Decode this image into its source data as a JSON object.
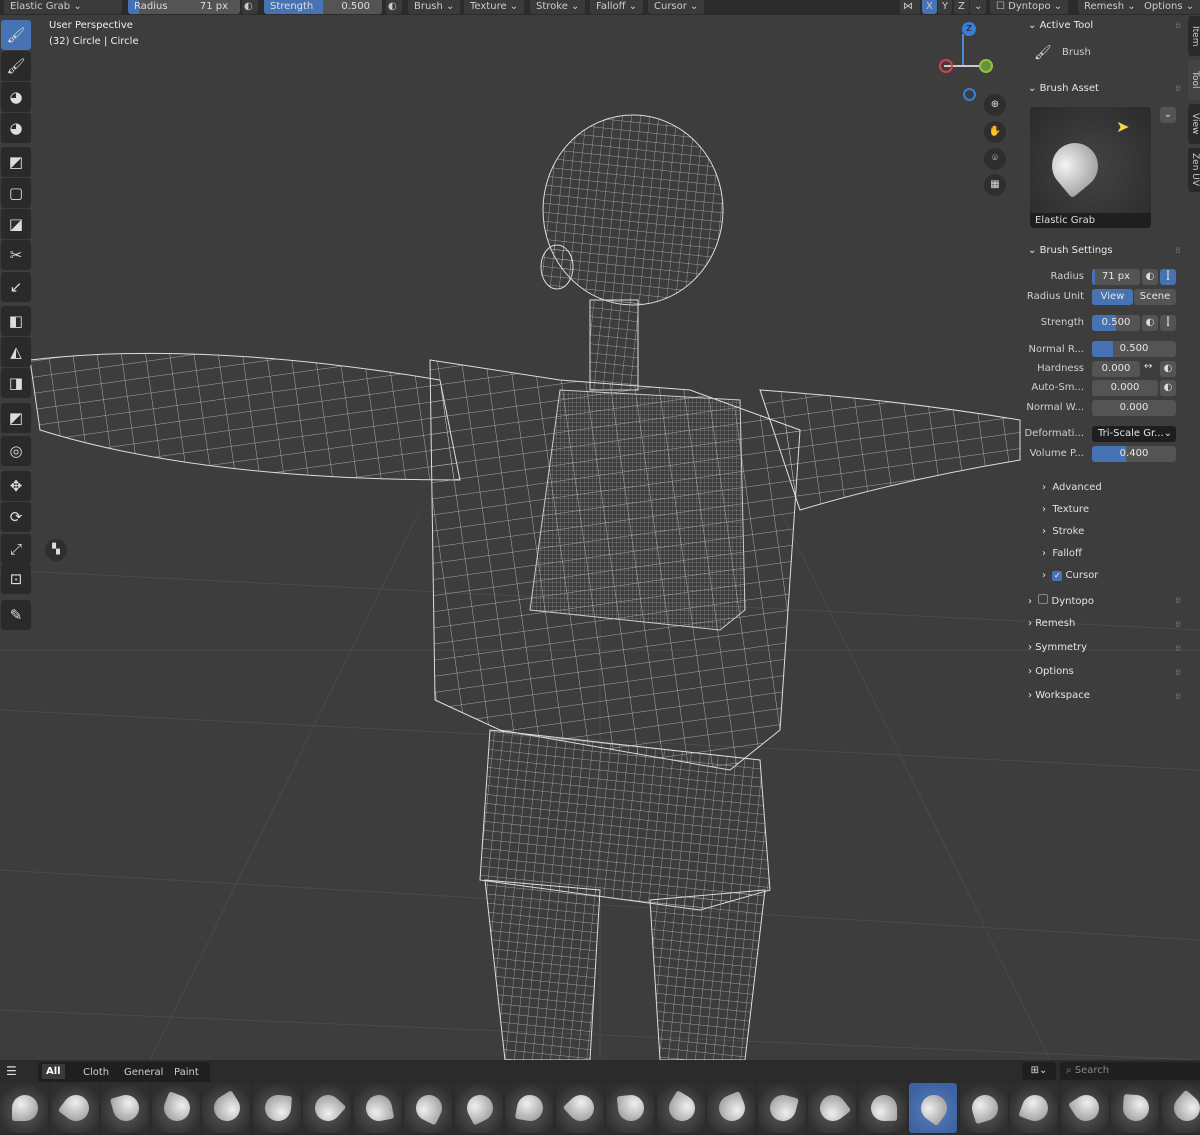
{
  "header": {
    "mode_label": "Elastic Grab",
    "radius_label": "Radius",
    "radius_value": "71 px",
    "strength_label": "Strength",
    "strength_value": "0.500",
    "strength_fraction": 0.5,
    "menus": [
      "Brush",
      "Texture",
      "Stroke",
      "Falloff",
      "Cursor"
    ],
    "axis_x": "X",
    "axis_y": "Y",
    "axis_z": "Z",
    "dyntopo": "Dyntopo",
    "remesh": "Remesh",
    "options": "Options"
  },
  "viewport": {
    "perspective": "User Perspective",
    "object_info": "(32) Circle | Circle",
    "gizmo": {
      "z": "Z",
      "y": "Y",
      "x": "X"
    }
  },
  "toolbar": {
    "tools": [
      "draw-brush",
      "smooth-brush",
      "mask-brush",
      "face-set-brush",
      "box-mask",
      "box-hide",
      "box-face-set",
      "box-trim",
      "line-project",
      "mesh-filter",
      "cloth-filter",
      "color-filter",
      "edit-face-set",
      "mask-by-color",
      "move",
      "rotate",
      "scale",
      "transform",
      "annotate"
    ]
  },
  "panel": {
    "active_tool": {
      "title": "Active Tool",
      "tool_name": "Brush"
    },
    "brush_asset": {
      "title": "Brush Asset",
      "name": "Elastic Grab"
    },
    "brush_settings": {
      "title": "Brush Settings",
      "radius": {
        "label": "Radius",
        "value": "71 px",
        "fraction": 0.07
      },
      "radius_unit": {
        "label": "Radius Unit",
        "options": [
          "View",
          "Scene"
        ],
        "selected": "View"
      },
      "strength": {
        "label": "Strength",
        "value": "0.500",
        "fraction": 0.5
      },
      "normal_radius": {
        "label": "Normal R...",
        "value": "0.500",
        "fraction": 0.25
      },
      "hardness": {
        "label": "Hardness",
        "value": "0.000"
      },
      "auto_smooth": {
        "label": "Auto-Sm...",
        "value": "0.000"
      },
      "normal_weight": {
        "label": "Normal W...",
        "value": "0.000"
      },
      "deformation": {
        "label": "Deformati...",
        "value": "Tri-Scale Gr..."
      },
      "volume_preservation": {
        "label": "Volume P...",
        "value": "0.400",
        "fraction": 0.4
      }
    },
    "subpanels": [
      "Advanced",
      "Texture",
      "Stroke",
      "Falloff",
      "Cursor"
    ],
    "cursor_checked": true,
    "sections": [
      "Dyntopo",
      "Remesh",
      "Symmetry",
      "Options",
      "Workspace"
    ],
    "dyntopo_checked": false
  },
  "side_tabs": [
    "Item",
    "Tool",
    "View",
    "Zen UV"
  ],
  "shelf": {
    "tabs": [
      "All",
      "Cloth",
      "General",
      "Paint"
    ],
    "active_tab": "All",
    "search_placeholder": "Search",
    "brush_count": 24,
    "active_brush_index": 18
  }
}
